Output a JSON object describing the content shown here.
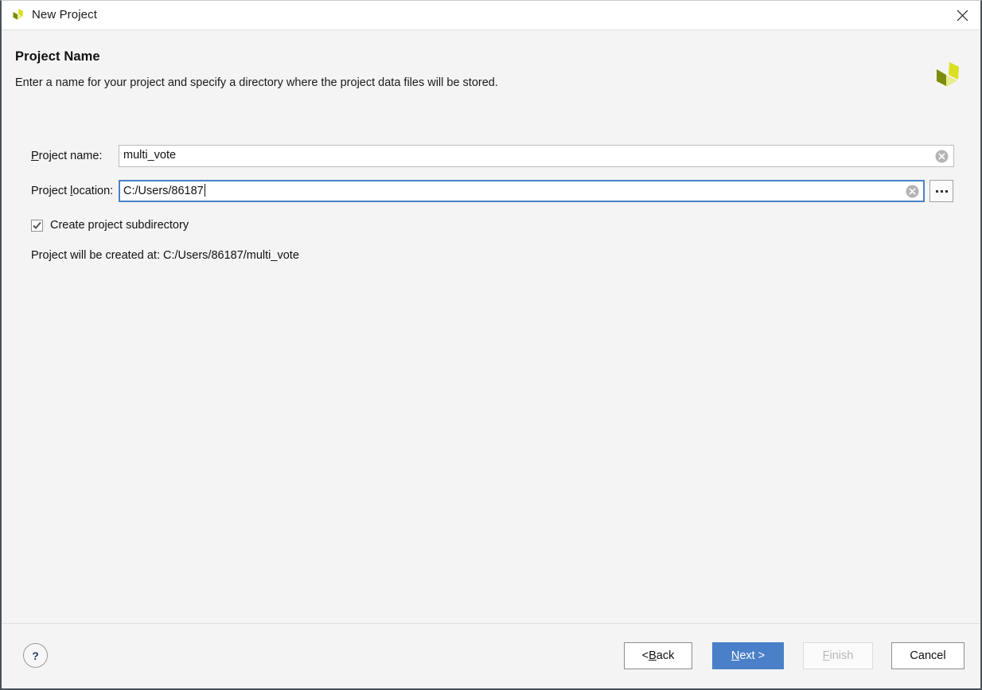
{
  "window": {
    "title": "New Project",
    "title_icon": "vivado-logo-icon",
    "close_icon": "close-icon"
  },
  "header": {
    "title": "Project Name",
    "description": "Enter a name for your project and specify a directory where the project data files will be stored.",
    "brand_icon": "vivado-logo-icon"
  },
  "form": {
    "project_name": {
      "label_pre": "",
      "label_mnemonic": "P",
      "label_post": "roject name:",
      "value": "multi_vote",
      "clear_icon": "clear-circle-icon"
    },
    "project_location": {
      "label_pre": "Project ",
      "label_mnemonic": "l",
      "label_post": "ocation:",
      "value": "C:/Users/86187",
      "clear_icon": "clear-circle-icon",
      "browse_icon": "ellipsis-icon",
      "focused": true
    },
    "create_subdirectory": {
      "label": "Create project subdirectory",
      "checked": true
    },
    "created_at_text": "Project will be created at: C:/Users/86187/multi_vote"
  },
  "footer": {
    "help_label": "?",
    "buttons": {
      "back": {
        "pre": "< ",
        "mnemonic": "B",
        "post": "ack"
      },
      "next": {
        "pre": "",
        "mnemonic": "N",
        "post": "ext >"
      },
      "finish": {
        "pre": "",
        "mnemonic": "F",
        "post": "inish"
      },
      "cancel": {
        "pre": "Cancel",
        "mnemonic": "",
        "post": ""
      }
    }
  },
  "colors": {
    "accent_blue": "#4a80c8",
    "body_bg": "#f4f4f4",
    "titlebar_bg": "#ffffff",
    "logo_dark": "#7d8c0b",
    "logo_bright": "#d9e021",
    "logo_pale": "#e8eb8e"
  }
}
